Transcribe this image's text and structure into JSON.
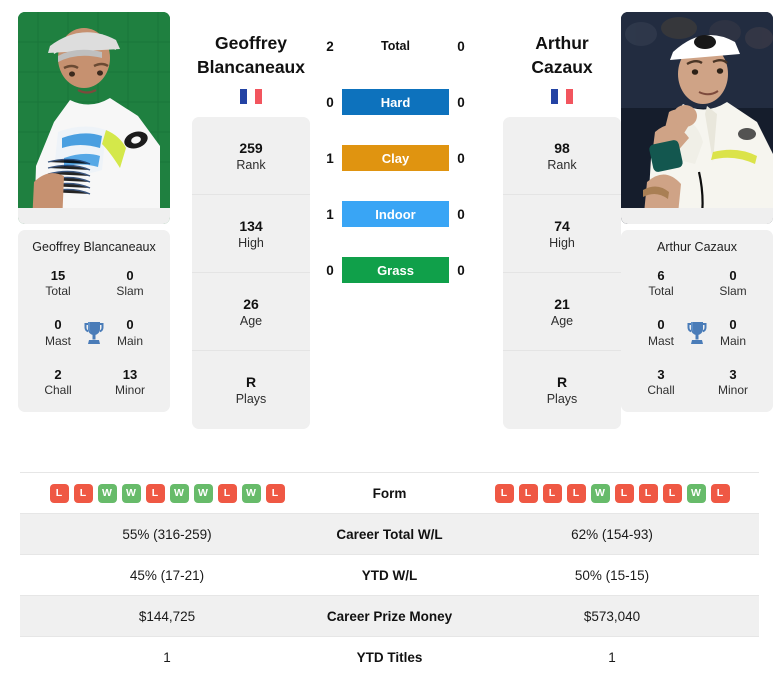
{
  "players": {
    "left": {
      "name_line1": "Geoffrey",
      "name_line2": "Blancaneaux",
      "full_name": "Geoffrey Blancaneaux",
      "country": "France",
      "flag": "fr-flag-icon",
      "photo_alt": "geoffrey-blancaneaux-photo",
      "rank": "259",
      "rank_label": "Rank",
      "high": "134",
      "high_label": "High",
      "age": "26",
      "age_label": "Age",
      "plays": "R",
      "plays_label": "Plays",
      "titles": {
        "total": "15",
        "total_label": "Total",
        "slam": "0",
        "slam_label": "Slam",
        "mast": "0",
        "mast_label": "Mast",
        "main": "0",
        "main_label": "Main",
        "chall": "2",
        "chall_label": "Chall",
        "minor": "13",
        "minor_label": "Minor"
      },
      "form": [
        "L",
        "L",
        "W",
        "W",
        "L",
        "W",
        "W",
        "L",
        "W",
        "L"
      ],
      "career_total_wl": "55% (316-259)",
      "ytd_wl": "45% (17-21)",
      "career_prize_money": "$144,725",
      "ytd_titles": "1"
    },
    "right": {
      "name_line1": "Arthur",
      "name_line2": "Cazaux",
      "full_name": "Arthur Cazaux",
      "country": "France",
      "flag": "fr-flag-icon",
      "photo_alt": "arthur-cazaux-photo",
      "rank": "98",
      "rank_label": "Rank",
      "high": "74",
      "high_label": "High",
      "age": "21",
      "age_label": "Age",
      "plays": "R",
      "plays_label": "Plays",
      "titles": {
        "total": "6",
        "total_label": "Total",
        "slam": "0",
        "slam_label": "Slam",
        "mast": "0",
        "mast_label": "Mast",
        "main": "0",
        "main_label": "Main",
        "chall": "3",
        "chall_label": "Chall",
        "minor": "3",
        "minor_label": "Minor"
      },
      "form": [
        "L",
        "L",
        "L",
        "L",
        "W",
        "L",
        "L",
        "L",
        "W",
        "L"
      ],
      "career_total_wl": "62% (154-93)",
      "ytd_wl": "50% (15-15)",
      "career_prize_money": "$573,040",
      "ytd_titles": "1"
    }
  },
  "head_to_head": [
    {
      "label": "Total",
      "left": "2",
      "right": "0",
      "color": "",
      "style": "plain"
    },
    {
      "label": "Hard",
      "left": "0",
      "right": "0",
      "color": "#0d72bd",
      "style": "bar"
    },
    {
      "label": "Clay",
      "left": "1",
      "right": "0",
      "color": "#e09410",
      "style": "bar"
    },
    {
      "label": "Indoor",
      "left": "1",
      "right": "0",
      "color": "#39a5f5",
      "style": "bar"
    },
    {
      "label": "Grass",
      "left": "0",
      "right": "0",
      "color": "#10a04a",
      "style": "bar"
    }
  ],
  "table": {
    "rows": [
      {
        "label": "Form",
        "type": "form",
        "left": "",
        "right": ""
      },
      {
        "label": "Career Total W/L",
        "type": "text",
        "left": "55% (316-259)",
        "right": "62% (154-93)"
      },
      {
        "label": "YTD W/L",
        "type": "text",
        "left": "45% (17-21)",
        "right": "50% (15-15)"
      },
      {
        "label": "Career Prize Money",
        "type": "text",
        "left": "$144,725",
        "right": "$573,040"
      },
      {
        "label": "YTD Titles",
        "type": "text",
        "left": "1",
        "right": "1"
      }
    ]
  },
  "colors": {
    "hard": "#0d72bd",
    "clay": "#e09410",
    "indoor": "#39a5f5",
    "grass": "#10a04a",
    "win": "#67bb6a",
    "loss": "#ef5844",
    "trophy": "#4a7cb8",
    "card_bg": "#f0f0f0"
  }
}
